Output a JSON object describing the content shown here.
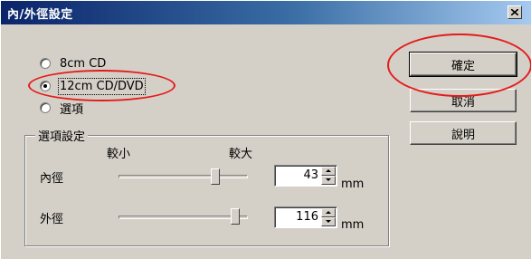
{
  "window": {
    "title": "內/外徑設定",
    "close_label": "×"
  },
  "disc_options": [
    {
      "label": "8cm CD",
      "selected": false
    },
    {
      "label": "12cm CD/DVD",
      "selected": true
    },
    {
      "label": "選項",
      "selected": false
    }
  ],
  "options_group": {
    "title": "選項設定",
    "scale_min_label": "較小",
    "scale_max_label": "較大",
    "inner": {
      "label": "內徑",
      "value": "43",
      "unit": "mm"
    },
    "outer": {
      "label": "外徑",
      "value": "116",
      "unit": "mm"
    }
  },
  "buttons": {
    "ok": "確定",
    "cancel": "取消",
    "help": "說明"
  },
  "annotation_color": "#e41b1b"
}
